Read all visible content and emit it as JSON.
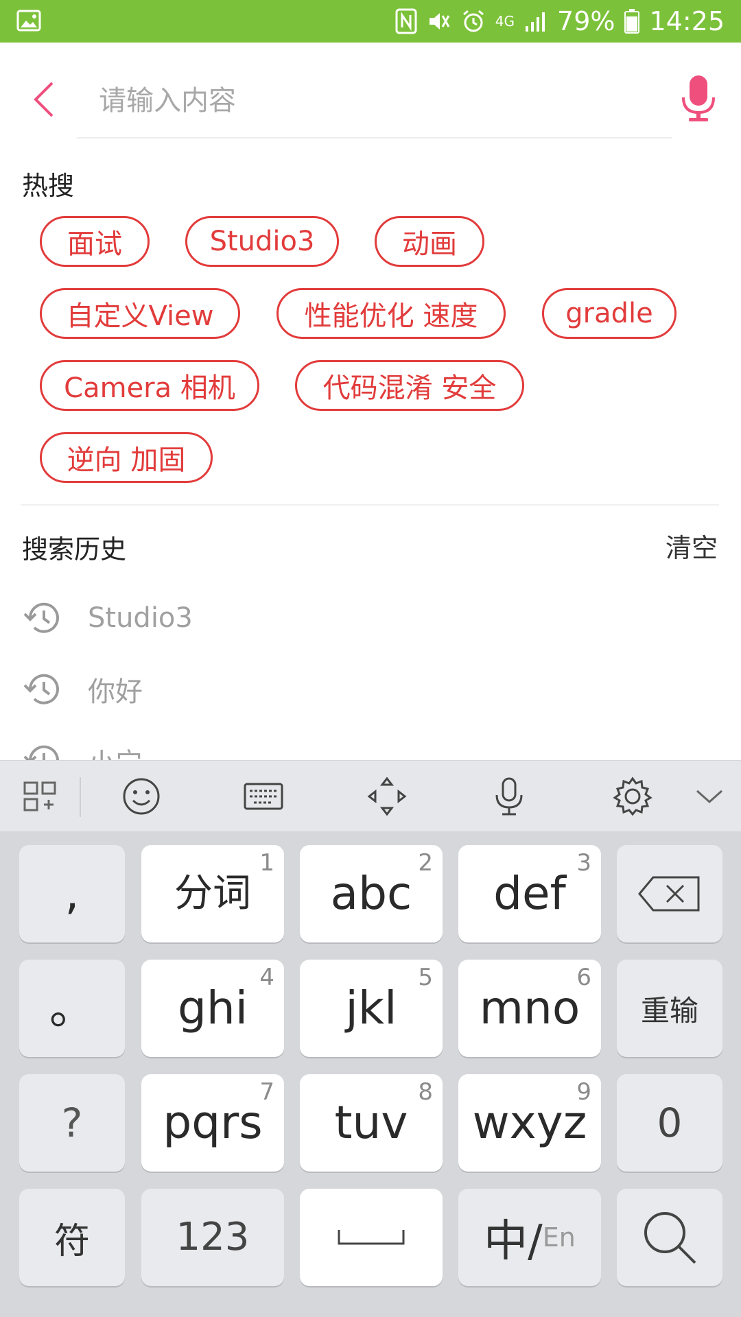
{
  "status_bar": {
    "battery": "79%",
    "time": "14:25",
    "network": "4G"
  },
  "search": {
    "placeholder": "请输入内容",
    "value": ""
  },
  "hot_search": {
    "title": "热搜",
    "tags": [
      "面试",
      "Studio3",
      "动画",
      "自定义View",
      "性能优化 速度",
      "gradle",
      "Camera 相机",
      "代码混淆 安全",
      "逆向 加固"
    ]
  },
  "history": {
    "title": "搜索历史",
    "clear_label": "清空",
    "items": [
      "Studio3",
      "你好",
      "小宁"
    ]
  },
  "keyboard": {
    "rows": [
      [
        {
          "main": ",",
          "sub": ""
        },
        {
          "main": "分词",
          "sub": "1"
        },
        {
          "main": "abc",
          "sub": "2"
        },
        {
          "main": "def",
          "sub": "3"
        },
        {
          "main": "",
          "sub": "",
          "icon": "backspace-icon"
        }
      ],
      [
        {
          "main": "。",
          "sub": ""
        },
        {
          "main": "ghi",
          "sub": "4"
        },
        {
          "main": "jkl",
          "sub": "5"
        },
        {
          "main": "mno",
          "sub": "6"
        },
        {
          "main": "重输",
          "sub": ""
        }
      ],
      [
        {
          "main": "?",
          "sub": ""
        },
        {
          "main": "pqrs",
          "sub": "7"
        },
        {
          "main": "tuv",
          "sub": "8"
        },
        {
          "main": "wxyz",
          "sub": "9"
        },
        {
          "main": "0",
          "sub": ""
        }
      ],
      [
        {
          "main": "符",
          "sub": ""
        },
        {
          "main": "123",
          "sub": ""
        },
        {
          "main": "",
          "sub": "",
          "icon": "space-icon"
        },
        {
          "main": "中/",
          "sub": "En"
        },
        {
          "main": "",
          "sub": "",
          "icon": "search-icon"
        }
      ]
    ]
  },
  "colors": {
    "status_bar": "#7cc13a",
    "accent": "#e23b3b",
    "mic": "#ef4f7d"
  }
}
